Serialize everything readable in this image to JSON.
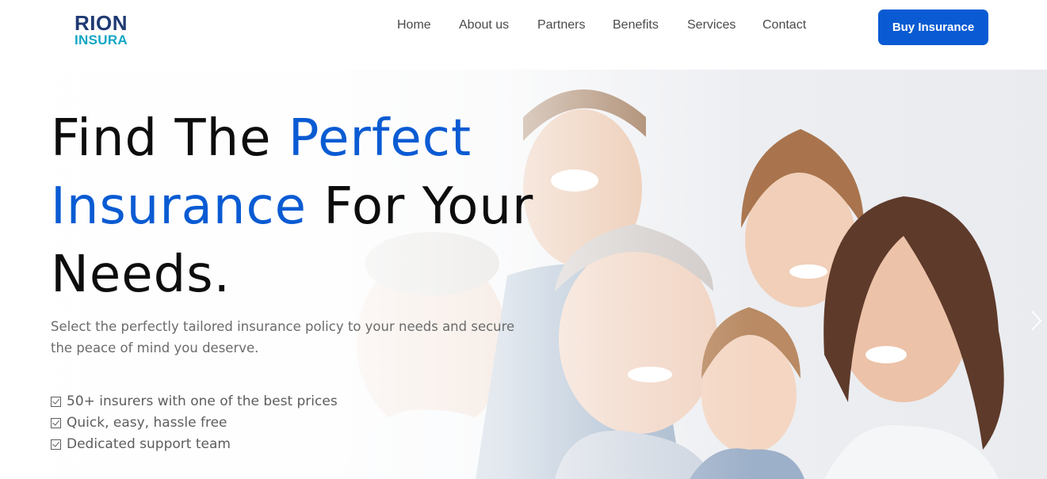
{
  "brand": {
    "logo_top": "RION",
    "logo_bottom": "INSURA",
    "primary_color": "#0a5bd3",
    "logo_dark": "#1f3a73",
    "logo_teal": "#12a6c4"
  },
  "nav": {
    "items": [
      {
        "label": "Home"
      },
      {
        "label": "About us"
      },
      {
        "label": "Partners"
      },
      {
        "label": "Benefits"
      },
      {
        "label": "Services"
      },
      {
        "label": "Contact"
      }
    ],
    "cta_label": "Buy Insurance"
  },
  "hero": {
    "headline_part1": "Find The ",
    "headline_accent1": "Perfect Insurance",
    "headline_part2": " For Your Needs.",
    "subtext": "Select the perfectly tailored insurance policy to your needs and secure the peace of mind you deserve.",
    "features": [
      "50+ insurers with one of the best prices",
      "Quick, easy, hassle free",
      "Dedicated support team"
    ],
    "next_icon": "chevron-right-icon"
  }
}
